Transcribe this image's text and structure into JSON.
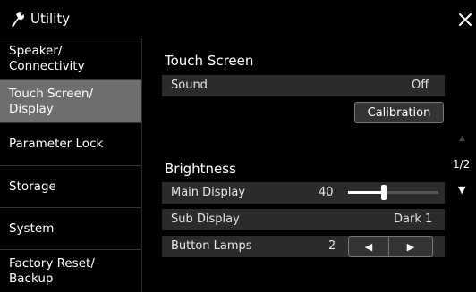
{
  "titlebar": {
    "icon": "wrench-icon",
    "title": "Utility",
    "close_icon": "close-icon"
  },
  "sidebar": {
    "items": [
      {
        "label_line1": "Speaker/",
        "label_line2": "Connectivity",
        "active": false
      },
      {
        "label_line1": "Touch Screen/",
        "label_line2": "Display",
        "active": true
      },
      {
        "label_line1": "Parameter Lock",
        "label_line2": "",
        "active": false
      },
      {
        "label_line1": "Storage",
        "label_line2": "",
        "active": false
      },
      {
        "label_line1": "System",
        "label_line2": "",
        "active": false
      },
      {
        "label_line1": "Factory Reset/",
        "label_line2": "Backup",
        "active": false
      }
    ]
  },
  "touch_screen": {
    "title": "Touch Screen",
    "sound_label": "Sound",
    "sound_value": "Off",
    "calibration_button": "Calibration"
  },
  "brightness": {
    "title": "Brightness",
    "main_display_label": "Main Display",
    "main_display_value": "40",
    "main_display_level": 0.4,
    "sub_display_label": "Sub Display",
    "sub_display_value": "Dark 1",
    "button_lamps_label": "Button Lamps",
    "button_lamps_value": "2",
    "decrease_glyph": "◀",
    "increase_glyph": "▶"
  },
  "pager": {
    "page": "1/2",
    "up_glyph": "▲",
    "down_glyph": "▼"
  }
}
